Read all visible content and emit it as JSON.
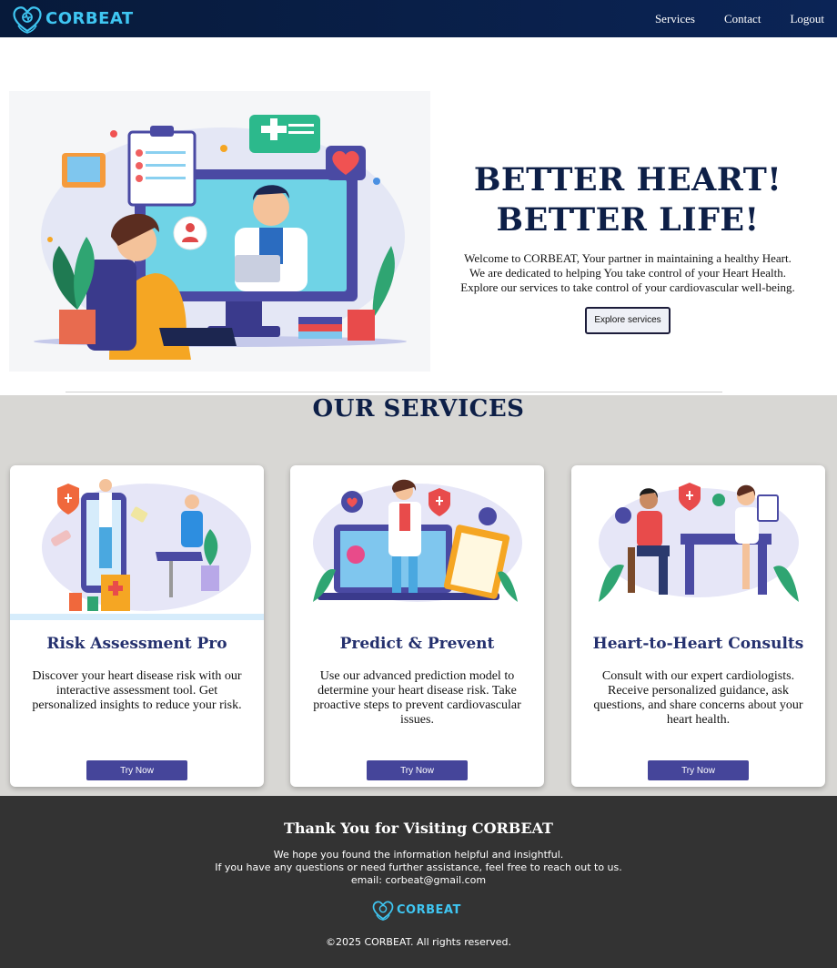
{
  "navbar": {
    "brand": "CORBEAT",
    "links": [
      "Services",
      "Contact",
      "Logout"
    ]
  },
  "hero": {
    "title_line1": "BETTER HEART!",
    "title_line2": "BETTER LIFE!",
    "desc_line1": "Welcome to CORBEAT, Your partner in maintaining a healthy Heart.",
    "desc_line2": "We are dedicated to helping You take control of your Heart Health.",
    "desc_line3": "Explore our services to take control of your cardiovascular well-being.",
    "explore_label": "Explore services"
  },
  "services": {
    "title": "OUR SERVICES",
    "cards": [
      {
        "title": "Risk Assessment Pro",
        "desc": "Discover your heart disease risk with our interactive assessment tool. Get personalized insights to reduce your risk.",
        "button": "Try Now"
      },
      {
        "title": "Predict & Prevent",
        "desc": "Use our advanced prediction model to determine your heart disease risk. Take proactive steps to prevent cardiovascular issues.",
        "button": "Try Now"
      },
      {
        "title": "Heart-to-Heart Consults",
        "desc": "Consult with our expert cardiologists. Receive personalized guidance, ask questions, and share concerns about your heart health.",
        "button": "Try Now"
      }
    ]
  },
  "footer": {
    "title": "Thank You for Visiting CORBEAT",
    "line1": "We hope you found the information helpful and insightful.",
    "line2": "If you have any questions or need further assistance, feel free to reach out to us.",
    "line3": "email: corbeat@gmail.com",
    "brand": "CORBEAT",
    "copyright": "©2025 CORBEAT. All rights reserved."
  },
  "colors": {
    "navbar": "#0b2456",
    "brand_accent": "#3fc6f2",
    "heading": "#0d1f47",
    "card_title": "#24306e",
    "button": "#45459a",
    "services_bg": "#d8d7d4",
    "footer_bg": "#333333"
  }
}
